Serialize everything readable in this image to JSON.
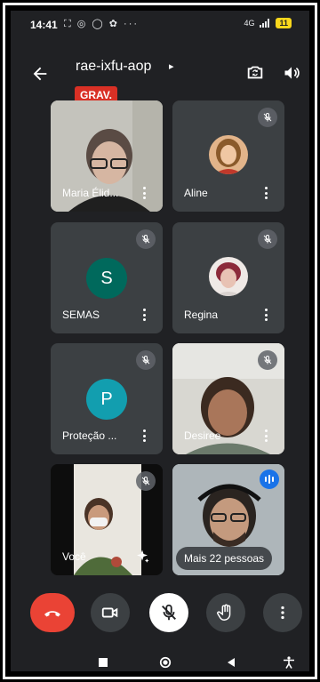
{
  "status_bar": {
    "time": "14:41",
    "notification_icons": [
      "photo-icon",
      "whatsapp-icon",
      "whatsapp-icon",
      "puzzle-icon",
      "more-icon"
    ],
    "notification_glyphs": "⛶ ◎ ◯ ✿ ···",
    "signal_label": "4G",
    "battery_label": "11"
  },
  "header": {
    "meeting_code": "rae-ixfu-aop",
    "caret": "▸",
    "recording_badge": "GRAV."
  },
  "participants": [
    {
      "name": "Maria Élid...",
      "muted": false,
      "kind": "video"
    },
    {
      "name": "Aline",
      "muted": true,
      "kind": "photo"
    },
    {
      "name": "SEMAS",
      "muted": true,
      "kind": "letter",
      "letter": "S",
      "color": "#00695c"
    },
    {
      "name": "Regina",
      "muted": true,
      "kind": "photo"
    },
    {
      "name": "Proteção ...",
      "muted": true,
      "kind": "letter",
      "letter": "P",
      "color": "#129eaf"
    },
    {
      "name": "Desiree",
      "muted": true,
      "kind": "video"
    },
    {
      "name": "Você",
      "muted": true,
      "kind": "video"
    },
    {
      "name": "Mais 22 pessoas",
      "muted": false,
      "kind": "video",
      "speaking": true
    }
  ],
  "colors": {
    "background": "#202124",
    "tile": "#3c4043",
    "end_call": "#ea4335",
    "recording": "#d93025",
    "speaking": "#1a73e8"
  }
}
